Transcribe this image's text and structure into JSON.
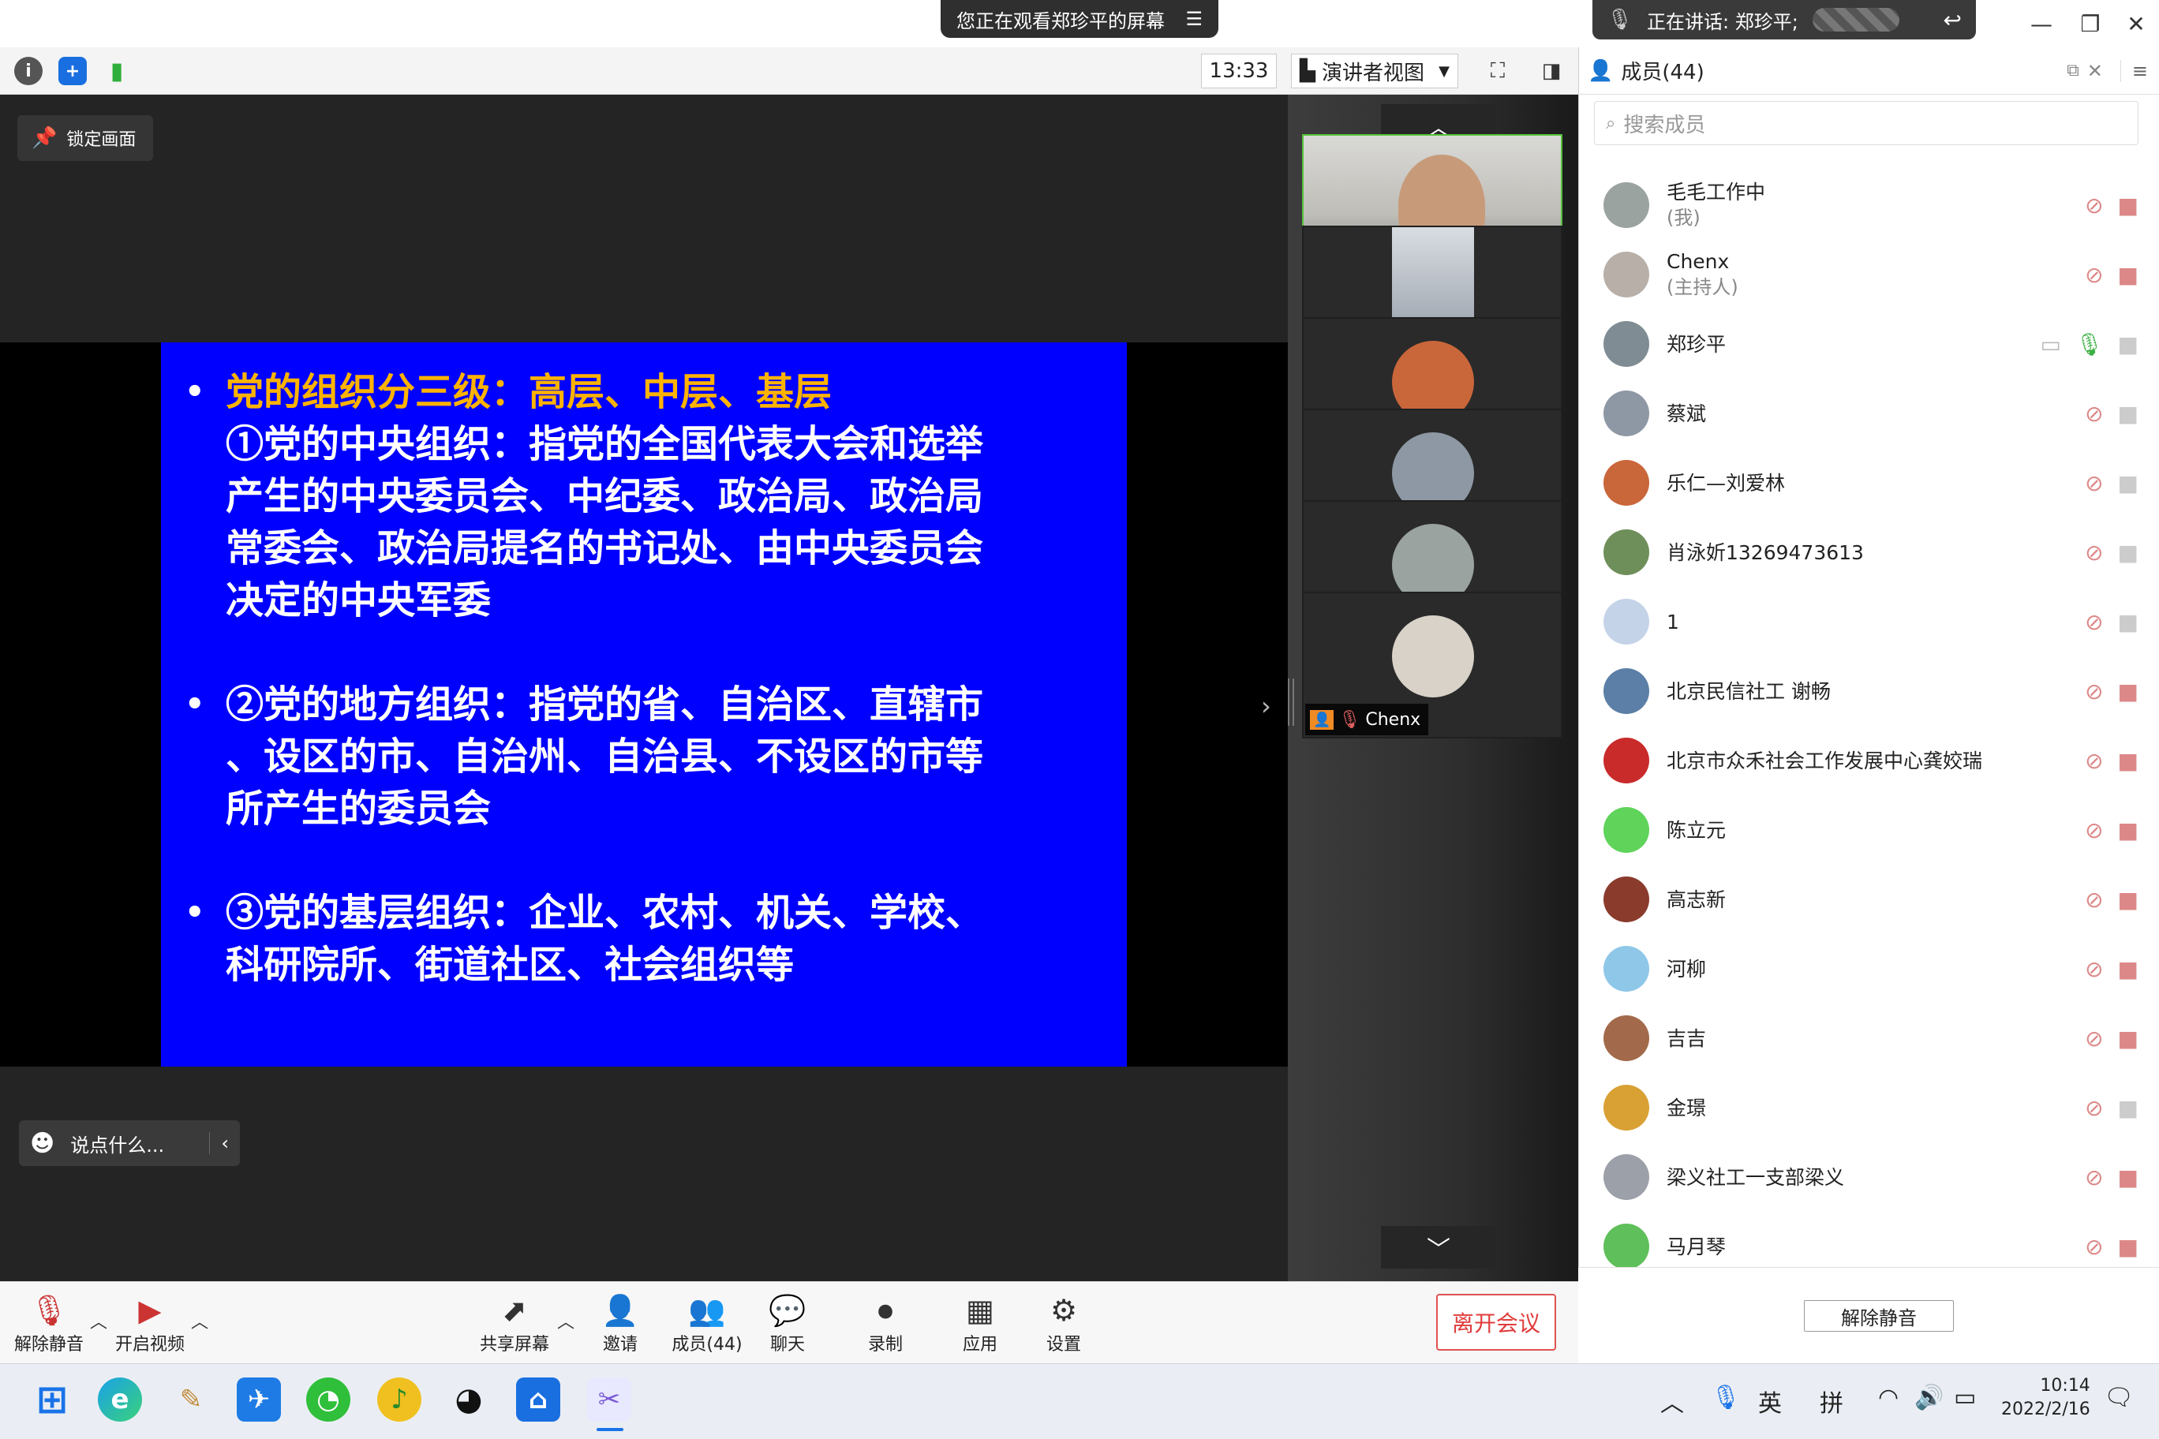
{
  "window": {
    "viewing_banner": "您正在观看郑珍平的屏幕",
    "speaking_label": "正在讲话: 郑珍平;"
  },
  "toolbar": {
    "time": "13:33",
    "view_mode": "演讲者视图"
  },
  "stage": {
    "lock_label": "锁定画面",
    "chat_placeholder": "说点什么..."
  },
  "slide": {
    "items": [
      {
        "lines": [
          "党的组织分三级：高层、中层、基层",
          "①党的中央组织：指党的全国代表大会和选举",
          "产生的中央委员会、中纪委、政治局、政治局",
          "常委会、政治局提名的书记处、由中央委员会",
          "决定的中央军委"
        ]
      },
      {
        "lines": [
          "②党的地方组织：指党的省、自治区、直辖市",
          "、设区的市、自治州、自治县、不设区的市等",
          "所产生的委员会"
        ]
      },
      {
        "lines": [
          "③党的基层组织：企业、农村、机关、学校、",
          "科研院所、街道社区、社会组织等"
        ]
      }
    ],
    "highlight_color": "#ffb300",
    "background_color": "#0000ff"
  },
  "video_tiles": [
    {
      "name": "郑珍平",
      "speaking": true
    },
    {
      "name": "肖泳妡13269473613",
      "speaking": false
    },
    {
      "name": "乐仁—刘爱林",
      "speaking": false
    },
    {
      "name": "蔡斌",
      "speaking": false
    },
    {
      "name": "毛毛工作中",
      "speaking": false
    },
    {
      "name": "Chenx",
      "speaking": false
    }
  ],
  "bottom_bar": {
    "unmute": "解除静音",
    "start_video": "开启视频",
    "share_screen": "共享屏幕",
    "invite": "邀请",
    "members": "成员(44)",
    "chat": "聊天",
    "record": "录制",
    "apps": "应用",
    "settings": "设置",
    "leave": "离开会议"
  },
  "members_panel": {
    "title": "成员(44)",
    "search_placeholder": "搜索成员",
    "unmute_all": "解除静音",
    "members": [
      {
        "name": "毛毛工作中",
        "role": "(我)",
        "avatar_color": "#9aa3a0"
      },
      {
        "name": "Chenx",
        "role": "(主持人)",
        "avatar_color": "#b8b0a8"
      },
      {
        "name": "郑珍平",
        "role": "",
        "avatar_color": "#7f8c94"
      },
      {
        "name": "蔡斌",
        "role": "",
        "avatar_color": "#8e98a4"
      },
      {
        "name": "乐仁—刘爱林",
        "role": "",
        "avatar_color": "#c9663a"
      },
      {
        "name": "肖泳妡13269473613",
        "role": "",
        "avatar_color": "#6f8f5a"
      },
      {
        "name": "1",
        "role": "",
        "avatar_color": "#c5d3e8"
      },
      {
        "name": "北京民信社工 谢畅",
        "role": "",
        "avatar_color": "#5b7fa6"
      },
      {
        "name": "北京市众禾社会工作发展中心龚姣瑞",
        "role": "",
        "avatar_color": "#c92b2b"
      },
      {
        "name": "陈立元",
        "role": "",
        "avatar_color": "#5fd35a"
      },
      {
        "name": "高志新",
        "role": "",
        "avatar_color": "#8a3b2c"
      },
      {
        "name": "河柳",
        "role": "",
        "avatar_color": "#8fc7e8"
      },
      {
        "name": "吉吉",
        "role": "",
        "avatar_color": "#a26a4a"
      },
      {
        "name": "金璟",
        "role": "",
        "avatar_color": "#d9a034"
      },
      {
        "name": "梁义社工一支部梁义",
        "role": "",
        "avatar_color": "#9ca0a8"
      },
      {
        "name": "马月琴",
        "role": "",
        "avatar_color": "#5fbf5a"
      }
    ]
  },
  "taskbar": {
    "ime_lang": "英",
    "ime_mode": "拼",
    "time": "10:14",
    "date": "2022/2/16"
  }
}
